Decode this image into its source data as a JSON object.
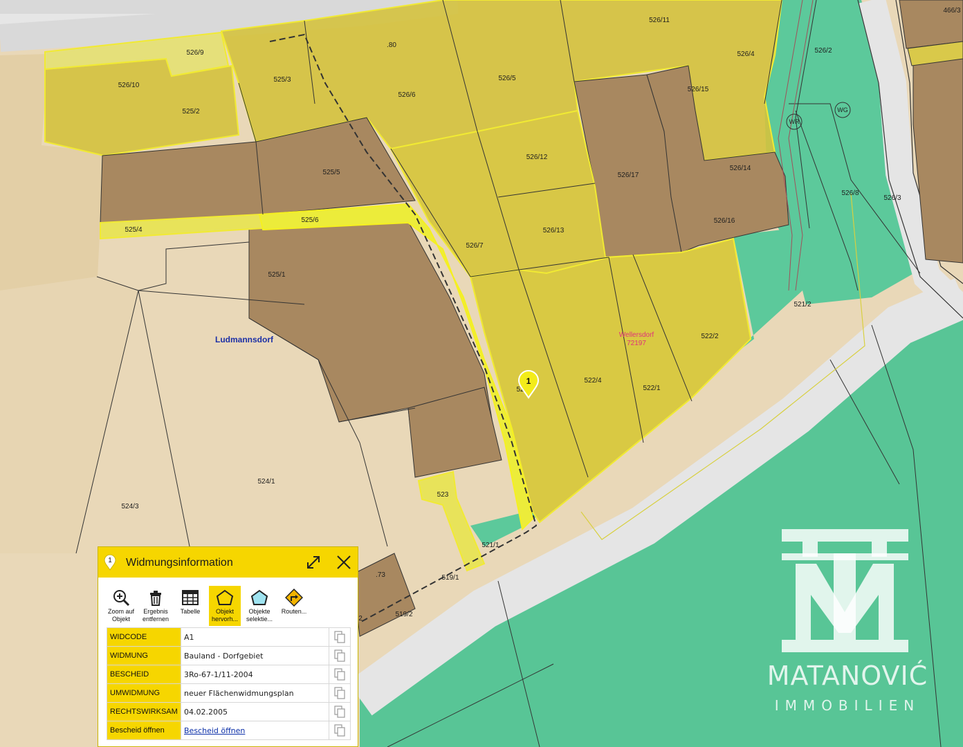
{
  "map": {
    "place_label": "Ludmannsdorf",
    "place_label_2": "Wellersdorf",
    "place_code_2": "72197",
    "marker_number": "1",
    "zone_symbols": [
      "WR",
      "WG"
    ],
    "parcels": [
      "526/9",
      "526/10",
      "525/2",
      "525/3",
      ".80",
      "526/6",
      "526/5",
      "526/11",
      "526/4",
      "526/2",
      "466/3",
      "526/15",
      "526/12",
      "526/17",
      "526/14",
      "526/8",
      "526/3",
      "525/5",
      "525/4",
      "525/6",
      "526/7",
      "526/13",
      "526/16",
      "525/1",
      "521/2",
      "522/2",
      "522/4",
      "522/1",
      "524/1",
      "524/3",
      "523",
      "521/1",
      "519/1",
      ".73",
      "519/2",
      "52",
      "2"
    ],
    "colors": {
      "bauland": "#d9c94a",
      "gruenland": "#5bc99a",
      "road": "#e6e6e6",
      "background": "#e9d8b8",
      "highlight": "#f2f200"
    }
  },
  "watermark": {
    "name": "MATANOVIĆ",
    "sub": "IMMOBILIEN"
  },
  "panel": {
    "badge": "1",
    "title": "Widmungsinformation",
    "tools": [
      {
        "label": "Zoom auf\nObjekt",
        "icon": "zoom-in-icon"
      },
      {
        "label": "Ergebnis\nentfernen",
        "icon": "trash-icon"
      },
      {
        "label": "Tabelle",
        "icon": "table-icon"
      },
      {
        "label": "Objekt\nhervorh...",
        "icon": "highlight-polygon-icon"
      },
      {
        "label": "Objekte\nselektie...",
        "icon": "select-polygon-icon"
      },
      {
        "label": "Routen...",
        "icon": "route-icon"
      }
    ],
    "rows": [
      {
        "key": "WIDCODE",
        "value": "A1"
      },
      {
        "key": "WIDMUNG",
        "value": "Bauland - Dorfgebiet"
      },
      {
        "key": "BESCHEID",
        "value": "3Ro-67-1/11-2004"
      },
      {
        "key": "UMWIDMUNG",
        "value": "neuer Flächenwidmungsplan"
      },
      {
        "key": "RECHTSWIRKSAM",
        "value": "04.02.2005"
      },
      {
        "key": "Bescheid öffnen",
        "value": "Bescheid öffnen"
      }
    ]
  }
}
